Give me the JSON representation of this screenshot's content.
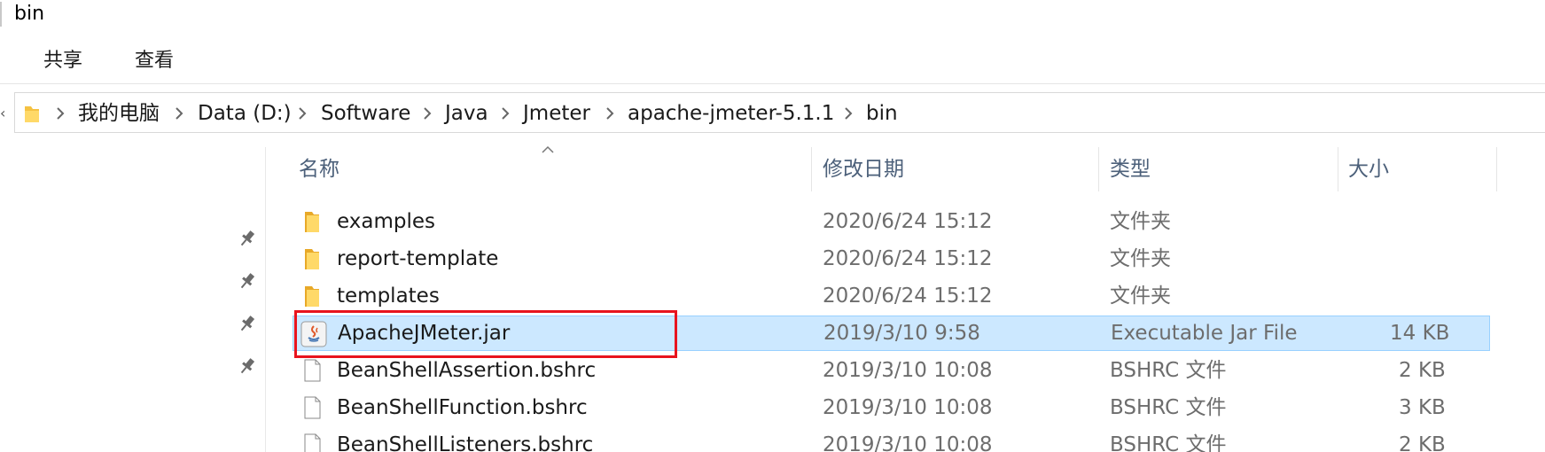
{
  "window": {
    "title": "bin"
  },
  "ribbon": {
    "tabs": [
      "共享",
      "查看"
    ]
  },
  "address_bar": {
    "crumbs": [
      "我的电脑",
      "Data (D:)",
      "Software",
      "Java",
      "Jmeter",
      "apache-jmeter-5.1.1",
      "bin"
    ]
  },
  "columns": {
    "name": "名称",
    "modified": "修改日期",
    "type": "类型",
    "size": "大小"
  },
  "files": [
    {
      "icon": "folder-icon",
      "name": "examples",
      "modified": "2020/6/24 15:12",
      "type": "文件夹",
      "size": ""
    },
    {
      "icon": "folder-icon",
      "name": "report-template",
      "modified": "2020/6/24 15:12",
      "type": "文件夹",
      "size": ""
    },
    {
      "icon": "folder-icon",
      "name": "templates",
      "modified": "2020/6/24 15:12",
      "type": "文件夹",
      "size": ""
    },
    {
      "icon": "java-jar-icon",
      "name": "ApacheJMeter.jar",
      "modified": "2019/3/10 9:58",
      "type": "Executable Jar File",
      "size": "14 KB",
      "selected": true
    },
    {
      "icon": "file-icon",
      "name": "BeanShellAssertion.bshrc",
      "modified": "2019/3/10 10:08",
      "type": "BSHRC 文件",
      "size": "2 KB"
    },
    {
      "icon": "file-icon",
      "name": "BeanShellFunction.bshrc",
      "modified": "2019/3/10 10:08",
      "type": "BSHRC 文件",
      "size": "3 KB"
    },
    {
      "icon": "file-icon",
      "name": "BeanShellListeners.bshrc",
      "modified": "2019/3/10 10:08",
      "type": "BSHRC 文件",
      "size": "2 KB"
    }
  ],
  "colors": {
    "selection_bg": "#cce8ff",
    "selection_border": "#99d1ff",
    "highlight_box": "#e8141e",
    "folder": "#f5c242",
    "header_text": "#4c607a"
  }
}
